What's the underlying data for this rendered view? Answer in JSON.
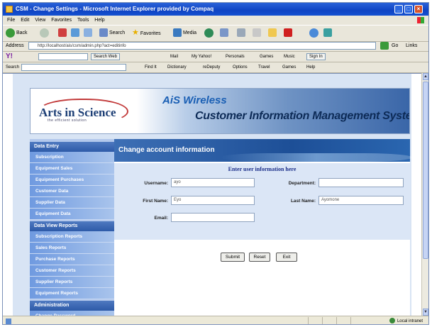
{
  "window": {
    "title": "CSM - Change Settings - Microsoft Internet Explorer provided by Compaq"
  },
  "menubar": [
    "File",
    "Edit",
    "View",
    "Favorites",
    "Tools",
    "Help"
  ],
  "toolbar": {
    "back": "Back",
    "search": "Search",
    "favorites": "Favorites",
    "media": "Media"
  },
  "address": {
    "label": "Address",
    "url": "http://localhost/ais/csm/admin.php?act=editinfo",
    "go": "Go",
    "links": "Links"
  },
  "yahoo": {
    "search_web": "Search Web",
    "items": [
      "Mail",
      "My Yahoo!",
      "Personals",
      "Games",
      "Music",
      "Sign In"
    ]
  },
  "links": {
    "search_label": "Search",
    "items": [
      "Find It",
      "Dictionary",
      "reDeputy",
      "Options",
      "Travel",
      "Games",
      "Help"
    ]
  },
  "banner": {
    "logo": "Arts in Science",
    "logo_sub": "the efficient solution",
    "title1": "AiS Wireless",
    "title2": "Customer Information Management System"
  },
  "sidebar": {
    "sections": [
      {
        "label": "Data Entry",
        "items": [
          "Subscription",
          "Equipment Sales",
          "Equipment Purchases",
          "Customer Data",
          "Supplier Data",
          "Equipment Data"
        ]
      },
      {
        "label": "Data View Reports",
        "items": [
          "Subscription Reports",
          "Sales Reports",
          "Purchase Reports",
          "Customer Reports",
          "Supplier Reports",
          "Equipment Reports"
        ]
      },
      {
        "label": "Administration",
        "items": [
          "Change Password"
        ]
      }
    ]
  },
  "content": {
    "heading": "Change account information",
    "instruction": "Enter user information here",
    "fields": {
      "username": {
        "label": "Username:",
        "value": "ayo"
      },
      "department": {
        "label": "Department:",
        "value": ""
      },
      "first_name": {
        "label": "First Name:",
        "value": "Eyo"
      },
      "last_name": {
        "label": "Last Name:",
        "value": "Ayomone"
      },
      "email": {
        "label": "Email:",
        "value": ""
      }
    },
    "buttons": {
      "submit": "Submit",
      "reset": "Reset",
      "exit": "Exit"
    }
  },
  "status": {
    "zone": "Local intranet"
  },
  "colors": {
    "sidebar_header": "#2d5aa8",
    "content_header": "#1d4f97",
    "xp_title": "#0f44c4"
  }
}
